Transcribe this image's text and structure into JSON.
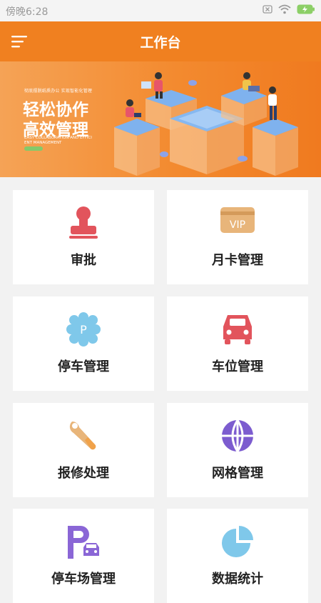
{
  "status_bar": {
    "time": "傍晚6:28"
  },
  "header": {
    "title": "工作台",
    "accent_color": "#f08020"
  },
  "banner": {
    "tagline": "彻底摆脱纸质办公 实现智能化管理",
    "line1": "轻松协作",
    "line2": "高效管理",
    "en_line1": "EASY COLLABORATION AND EFFICI",
    "en_line2": "ENT MANAGEMENT"
  },
  "grid": {
    "items": [
      {
        "label": "审批",
        "icon": "stamp-icon"
      },
      {
        "label": "月卡管理",
        "icon": "vip-card-icon"
      },
      {
        "label": "停车管理",
        "icon": "parking-badge-icon"
      },
      {
        "label": "车位管理",
        "icon": "car-icon"
      },
      {
        "label": "报修处理",
        "icon": "wrench-icon"
      },
      {
        "label": "网格管理",
        "icon": "globe-grid-icon"
      },
      {
        "label": "停车场管理",
        "icon": "parking-lot-icon"
      },
      {
        "label": "数据统计",
        "icon": "pie-chart-icon"
      }
    ]
  }
}
